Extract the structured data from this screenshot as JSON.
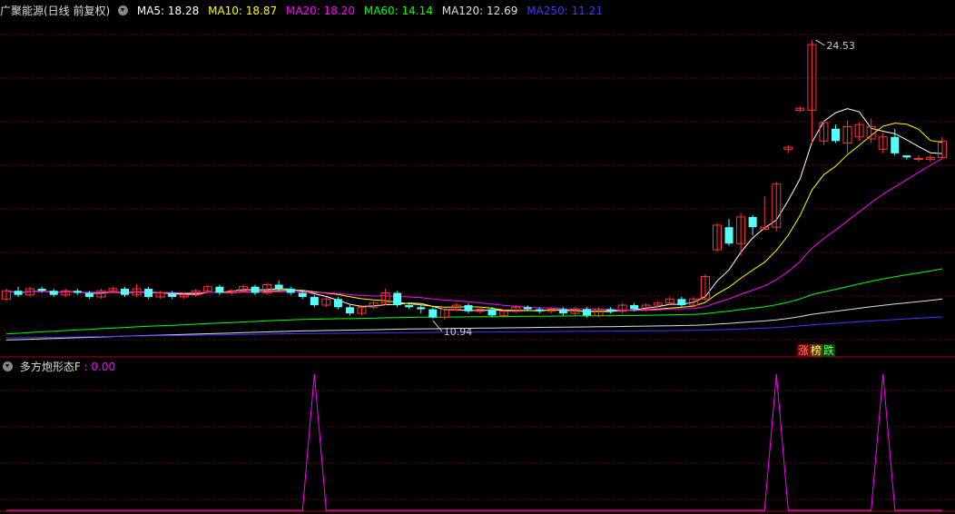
{
  "header": {
    "title": "广聚能源(日线 前复权)",
    "ma": [
      {
        "label": "MA5: 18.28",
        "color": "#ffffff"
      },
      {
        "label": "MA10: 18.87",
        "color": "#ffff00"
      },
      {
        "label": "MA20: 18.20",
        "color": "#ff00ff"
      },
      {
        "label": "MA60: 14.14",
        "color": "#00ff00"
      },
      {
        "label": "MA120: 12.69",
        "color": "#e0e0e0"
      },
      {
        "label": "MA250: 11.21",
        "color": "#3a3aff"
      }
    ]
  },
  "sub_header": {
    "title": "多方炮形态F",
    "value": ": 0.00",
    "value_color": "#ff00ff"
  },
  "legend_tags": {
    "up": "涨",
    "mid": "榜",
    "down": "跌"
  },
  "colors": {
    "up": "#ff3333",
    "down": "#54ffff",
    "grid": "#7a0000",
    "border": "#b00000",
    "indicator": "#ff00ff"
  },
  "chart_data": [
    {
      "type": "candlestick",
      "title": "广聚能源(日线 前复权)",
      "annotations": [
        {
          "text": "24.53",
          "price": 24.53
        },
        {
          "text": "10.94",
          "price": 10.94
        }
      ],
      "ylim": [
        9.3,
        25.5
      ],
      "candles": [
        [
          11.9,
          12.3,
          12.4,
          11.8
        ],
        [
          12.3,
          12.1,
          12.5,
          12.0
        ],
        [
          12.1,
          12.4,
          12.5,
          12.0
        ],
        [
          12.4,
          12.3,
          12.5,
          12.2
        ],
        [
          12.3,
          12.1,
          12.4,
          12.0
        ],
        [
          12.1,
          12.3,
          12.4,
          12.0
        ],
        [
          12.3,
          12.2,
          12.4,
          12.1
        ],
        [
          12.2,
          12.0,
          12.3,
          11.9
        ],
        [
          12.0,
          12.3,
          12.4,
          11.9
        ],
        [
          12.3,
          12.4,
          12.5,
          12.2
        ],
        [
          12.4,
          12.1,
          12.5,
          12.0
        ],
        [
          12.1,
          12.4,
          12.6,
          12.0
        ],
        [
          12.4,
          12.0,
          12.5,
          11.9
        ],
        [
          12.0,
          12.2,
          12.3,
          11.9
        ],
        [
          12.2,
          12.0,
          12.3,
          11.9
        ],
        [
          12.0,
          12.1,
          12.2,
          11.9
        ],
        [
          12.1,
          12.3,
          12.4,
          12.0
        ],
        [
          12.3,
          12.5,
          12.6,
          12.2
        ],
        [
          12.5,
          12.2,
          12.6,
          12.1
        ],
        [
          12.2,
          12.3,
          12.4,
          12.1
        ],
        [
          12.3,
          12.5,
          12.6,
          12.2
        ],
        [
          12.5,
          12.2,
          12.6,
          12.1
        ],
        [
          12.2,
          12.6,
          12.7,
          12.1
        ],
        [
          12.6,
          12.4,
          12.8,
          12.3
        ],
        [
          12.4,
          12.2,
          12.5,
          12.1
        ],
        [
          12.2,
          12.0,
          12.3,
          11.9
        ],
        [
          12.0,
          11.6,
          12.1,
          11.5
        ],
        [
          11.6,
          11.9,
          12.0,
          11.5
        ],
        [
          11.9,
          11.5,
          12.0,
          11.4
        ],
        [
          11.5,
          11.2,
          11.6,
          11.1
        ],
        [
          11.2,
          11.5,
          11.6,
          11.1
        ],
        [
          11.5,
          11.7,
          11.8,
          11.4
        ],
        [
          11.7,
          12.2,
          12.4,
          11.6
        ],
        [
          12.2,
          11.6,
          12.3,
          11.5
        ],
        [
          11.6,
          11.5,
          11.7,
          11.4
        ],
        [
          11.5,
          11.4,
          11.6,
          11.2
        ],
        [
          11.4,
          11.0,
          11.5,
          10.94
        ],
        [
          11.0,
          11.4,
          11.5,
          10.9
        ],
        [
          11.4,
          11.6,
          11.7,
          11.3
        ],
        [
          11.6,
          11.3,
          11.7,
          11.2
        ],
        [
          11.3,
          11.4,
          11.5,
          11.2
        ],
        [
          11.4,
          11.1,
          11.5,
          11.0
        ],
        [
          11.1,
          11.3,
          11.4,
          11.0
        ],
        [
          11.3,
          11.5,
          11.6,
          11.2
        ],
        [
          11.5,
          11.4,
          11.6,
          11.3
        ],
        [
          11.4,
          11.3,
          11.5,
          11.2
        ],
        [
          11.3,
          11.4,
          11.5,
          11.2
        ],
        [
          11.4,
          11.2,
          11.5,
          11.1
        ],
        [
          11.2,
          11.4,
          11.5,
          11.1
        ],
        [
          11.4,
          11.1,
          11.5,
          11.0
        ],
        [
          11.1,
          11.4,
          11.5,
          11.0
        ],
        [
          11.4,
          11.3,
          11.5,
          11.2
        ],
        [
          11.3,
          11.6,
          11.7,
          11.2
        ],
        [
          11.6,
          11.4,
          11.7,
          11.3
        ],
        [
          11.4,
          11.6,
          11.7,
          11.3
        ],
        [
          11.6,
          11.7,
          11.8,
          11.5
        ],
        [
          11.7,
          11.9,
          12.0,
          11.6
        ],
        [
          11.9,
          11.6,
          12.0,
          11.5
        ],
        [
          11.6,
          11.9,
          12.0,
          11.5
        ],
        [
          11.9,
          13.0,
          13.1,
          11.8
        ],
        [
          14.3,
          15.5,
          15.6,
          14.2
        ],
        [
          15.4,
          14.6,
          15.8,
          14.5
        ],
        [
          14.6,
          15.9,
          16.1,
          14.0
        ],
        [
          15.9,
          15.4,
          16.0,
          15.0
        ],
        [
          15.3,
          15.4,
          16.9,
          15.3
        ],
        [
          15.4,
          17.5,
          17.6,
          15.2
        ],
        [
          19.2,
          19.3,
          19.4,
          19.0
        ],
        [
          21.1,
          21.2,
          21.3,
          21.0
        ],
        [
          21.1,
          24.3,
          24.53,
          19.5
        ],
        [
          19.6,
          20.5,
          20.6,
          19.4
        ],
        [
          20.2,
          19.6,
          20.4,
          19.5
        ],
        [
          19.5,
          20.3,
          20.6,
          19.0
        ],
        [
          19.8,
          20.4,
          20.5,
          19.6
        ],
        [
          19.7,
          20.3,
          20.7,
          19.5
        ],
        [
          19.2,
          19.8,
          20.0,
          19.0
        ],
        [
          19.8,
          19.0,
          20.2,
          18.9
        ],
        [
          18.9,
          18.8,
          18.9,
          18.7
        ],
        [
          18.75,
          18.75,
          18.9,
          18.6
        ],
        [
          18.7,
          18.8,
          18.9,
          18.6
        ],
        [
          18.8,
          19.6,
          19.8,
          18.7
        ]
      ]
    },
    {
      "type": "line",
      "title": "多方炮形态F",
      "ylim": [
        0,
        1
      ],
      "values": [
        0,
        0,
        0,
        0,
        0,
        0,
        0,
        0,
        0,
        0,
        0,
        0,
        0,
        0,
        0,
        0,
        0,
        0,
        0,
        0,
        0,
        0,
        0,
        0,
        0,
        0,
        1,
        0,
        0,
        0,
        0,
        0,
        0,
        0,
        0,
        0,
        0,
        0,
        0,
        0,
        0,
        0,
        0,
        0,
        0,
        0,
        0,
        0,
        0,
        0,
        0,
        0,
        0,
        0,
        0,
        0,
        0,
        0,
        0,
        0,
        0,
        0,
        0,
        0,
        0,
        1,
        0,
        0,
        0,
        0,
        0,
        0,
        0,
        0,
        1,
        0,
        0,
        0,
        0,
        0
      ]
    }
  ]
}
